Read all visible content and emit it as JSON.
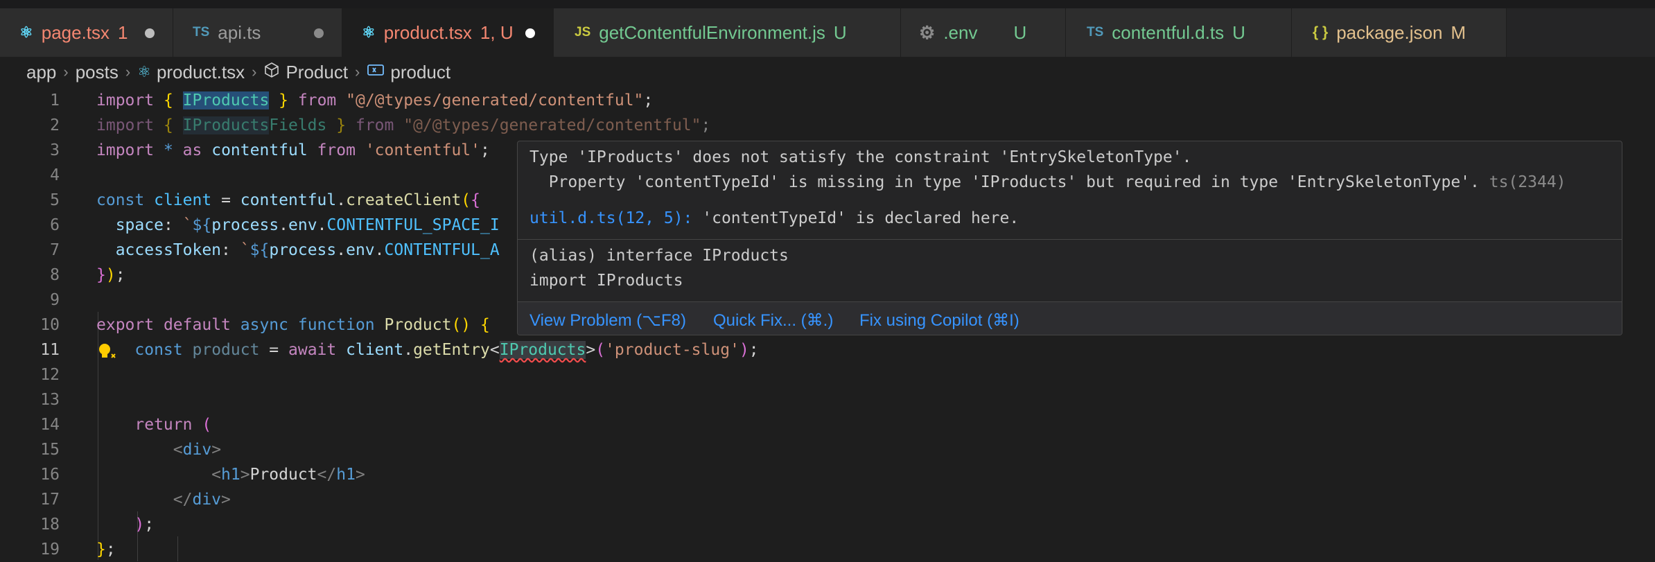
{
  "tabs": [
    {
      "icon": "react-icon",
      "glyph": "⚛",
      "icon_color": "#61dafb",
      "name": "page.tsx",
      "status": "1",
      "name_color": "#f48771",
      "status_color": "#f48771",
      "dirty": true
    },
    {
      "icon": "typescript-icon",
      "glyph": "TS",
      "icon_color": "#519aba",
      "name": "api.ts",
      "status": "",
      "name_color": "#9d9d9d",
      "status_color": "#9d9d9d",
      "dirty": true
    },
    {
      "icon": "react-icon",
      "glyph": "⚛",
      "icon_color": "#61dafb",
      "name": "product.tsx",
      "status": "1, U",
      "name_color": "#f48771",
      "status_color": "#f48771",
      "dirty": true,
      "active": true
    },
    {
      "icon": "javascript-icon",
      "glyph": "JS",
      "icon_color": "#cbcb41",
      "name": "getContentfulEnvironment.js",
      "status": "U",
      "name_color": "#73c991",
      "status_color": "#73c991",
      "dirty": false
    },
    {
      "icon": "gear-icon",
      "glyph": "⚙",
      "icon_color": "#8a8a8a",
      "name": ".env",
      "status": "U",
      "name_color": "#73c991",
      "status_color": "#73c991",
      "dirty": false
    },
    {
      "icon": "typescript-icon",
      "glyph": "TS",
      "icon_color": "#519aba",
      "name": "contentful.d.ts",
      "status": "U",
      "name_color": "#73c991",
      "status_color": "#73c991",
      "dirty": false
    },
    {
      "icon": "json-icon",
      "glyph": "{ }",
      "icon_color": "#cbcb41",
      "name": "package.json",
      "status": "M",
      "name_color": "#e2c08d",
      "status_color": "#e2c08d",
      "dirty": false
    }
  ],
  "breadcrumb": {
    "items": [
      "app",
      "posts",
      "product.tsx",
      "Product",
      "product"
    ],
    "icons": [
      "",
      "",
      "react-icon",
      "cube-icon",
      "variable-icon"
    ]
  },
  "editor": {
    "line_numbers": [
      "1",
      "2",
      "3",
      "4",
      "5",
      "6",
      "7",
      "8",
      "9",
      "10",
      "11",
      "12",
      "13",
      "14",
      "15",
      "16",
      "17",
      "18",
      "19"
    ],
    "current_line": "11"
  },
  "hover": {
    "line1": "Type 'IProducts' does not satisfy the constraint 'EntrySkeletonType'.",
    "line2": "  Property 'contentTypeId' is missing in type 'IProducts' but required in type 'EntrySkeletonType'.",
    "error_code": "ts(2344)",
    "related_link": "util.d.ts(12, 5):",
    "related_text": " 'contentTypeId' is declared here.",
    "alias_line": "(alias) interface IProducts",
    "import_line": "import IProducts",
    "actions": {
      "view_problem": "View Problem (⌥F8)",
      "quick_fix": "Quick Fix... (⌘.)",
      "fix_copilot": "Fix using Copilot (⌘I)"
    }
  },
  "colors": {
    "background": "#1e1e1e",
    "error": "#f14c4c",
    "link": "#3794ff",
    "untracked": "#73c991"
  }
}
